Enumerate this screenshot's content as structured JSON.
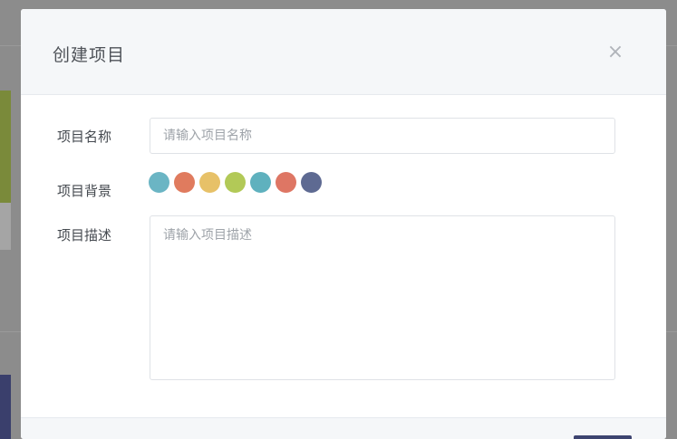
{
  "modal": {
    "title": "创建项目",
    "close_symbol": "×",
    "close_icon": "close-icon"
  },
  "form": {
    "name": {
      "label": "项目名称",
      "placeholder": "请输入项目名称",
      "value": ""
    },
    "background": {
      "label": "项目背景",
      "colors": [
        "#6bb5c4",
        "#e07b5e",
        "#e7c168",
        "#b2c957",
        "#5fb1be",
        "#de7664",
        "#5e6a92"
      ]
    },
    "description": {
      "label": "项目描述",
      "placeholder": "请输入项目描述",
      "value": ""
    }
  },
  "colors": {
    "overlay": "#8c8c8c",
    "footer_button": "#3d4470"
  }
}
